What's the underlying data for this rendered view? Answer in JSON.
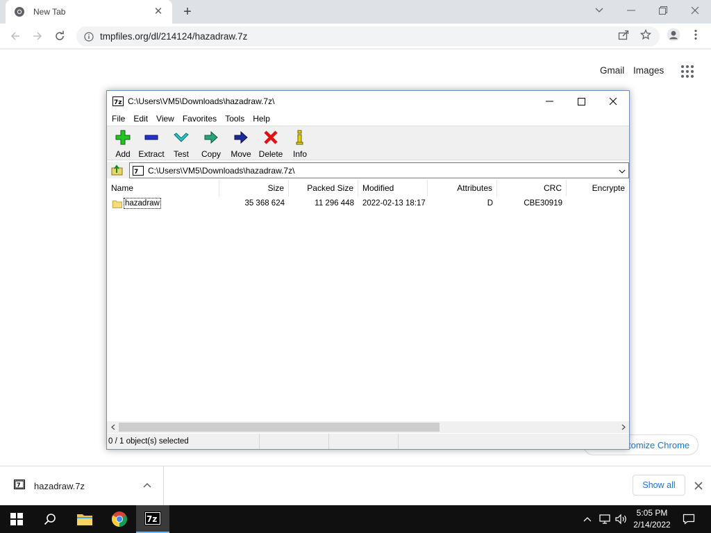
{
  "browser": {
    "tab": {
      "title": "New Tab"
    },
    "url": "tmpfiles.org/dl/214124/hazadraw.7z",
    "ntp": {
      "gmail": "Gmail",
      "images": "Images",
      "customize_partial": "tomize Chrome"
    }
  },
  "sevenzip": {
    "title": "C:\\Users\\VM5\\Downloads\\hazadraw.7z\\",
    "menu": [
      "File",
      "Edit",
      "View",
      "Favorites",
      "Tools",
      "Help"
    ],
    "toolbar": {
      "add": "Add",
      "extract": "Extract",
      "test": "Test",
      "copy": "Copy",
      "move": "Move",
      "delete": "Delete",
      "info": "Info"
    },
    "address": "C:\\Users\\VM5\\Downloads\\hazadraw.7z\\",
    "columns": {
      "name": "Name",
      "size": "Size",
      "packed": "Packed Size",
      "modified": "Modified",
      "attributes": "Attributes",
      "crc": "CRC",
      "encrypted": "Encrypte"
    },
    "rows": [
      {
        "name": "hazadraw",
        "size": "35 368 624",
        "packed": "11 296 448",
        "modified": "2022-02-13 18:17",
        "attributes": "D",
        "crc": "CBE30919",
        "encrypted": ""
      }
    ],
    "status": "0 / 1 object(s) selected"
  },
  "downloads": {
    "file": "hazadraw.7z",
    "show_all": "Show all"
  },
  "taskbar": {
    "time": "5:05 PM",
    "date": "2/14/2022"
  },
  "colors": {
    "chrome_tabstrip": "#dee1e6",
    "link_blue": "#1a73e8",
    "taskbar": "#101010"
  }
}
